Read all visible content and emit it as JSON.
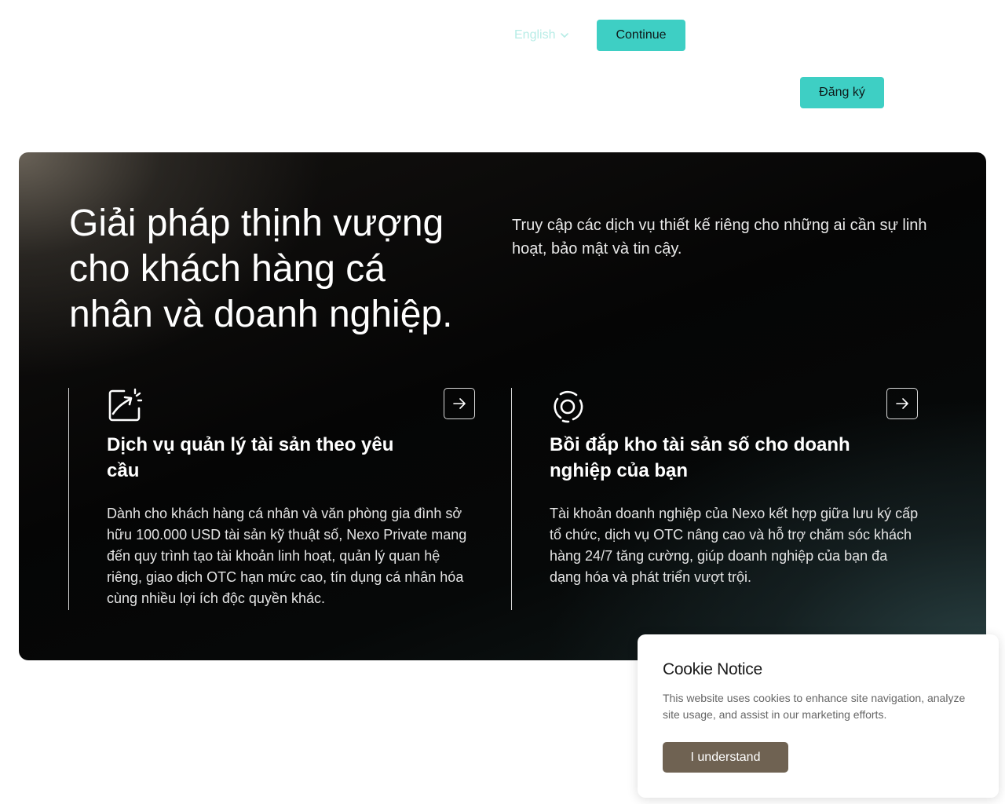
{
  "header": {
    "language_label": "English",
    "continue_label": "Continue",
    "register_label": "Đăng ký"
  },
  "hero": {
    "title": "Giải pháp thịnh vượng cho khách hàng cá nhân và doanh nghiệp.",
    "description": "Truy cập các dịch vụ thiết kế riêng cho những ai cần sự linh hoạt, bảo mật và tin cậy."
  },
  "cards": [
    {
      "icon": "chart-growth-icon",
      "title": "Dịch vụ quản lý tài sản theo yêu cầu",
      "text": "Dành cho khách hàng cá nhân và văn phòng gia đình sở hữu 100.000 USD tài sản kỹ thuật số, Nexo Private mang đến quy trình tạo tài khoản linh hoạt, quản lý quan hệ riêng, giao dịch OTC hạn mức cao, tín dụng cá nhân hóa cùng nhiều lợi ích độc quyền khác."
    },
    {
      "icon": "target-rings-icon",
      "title": "Bồi đắp kho tài sản số cho doanh nghiệp của bạn",
      "text": "Tài khoản doanh nghiệp của Nexo kết hợp giữa lưu ký cấp tổ chức, dịch vụ OTC nâng cao và hỗ trợ chăm sóc khách hàng 24/7 tăng cường, giúp doanh nghiệp của bạn đa dạng hóa và phát triển vượt trội."
    }
  ],
  "cookie": {
    "title": "Cookie Notice",
    "text": "This website uses cookies to enhance site navigation, analyze site usage, and assist in our marketing efforts.",
    "button_label": "I understand"
  },
  "colors": {
    "accent": "#3ecfc4",
    "cookie_button": "#6f6252",
    "language_text": "#b7ece6"
  }
}
